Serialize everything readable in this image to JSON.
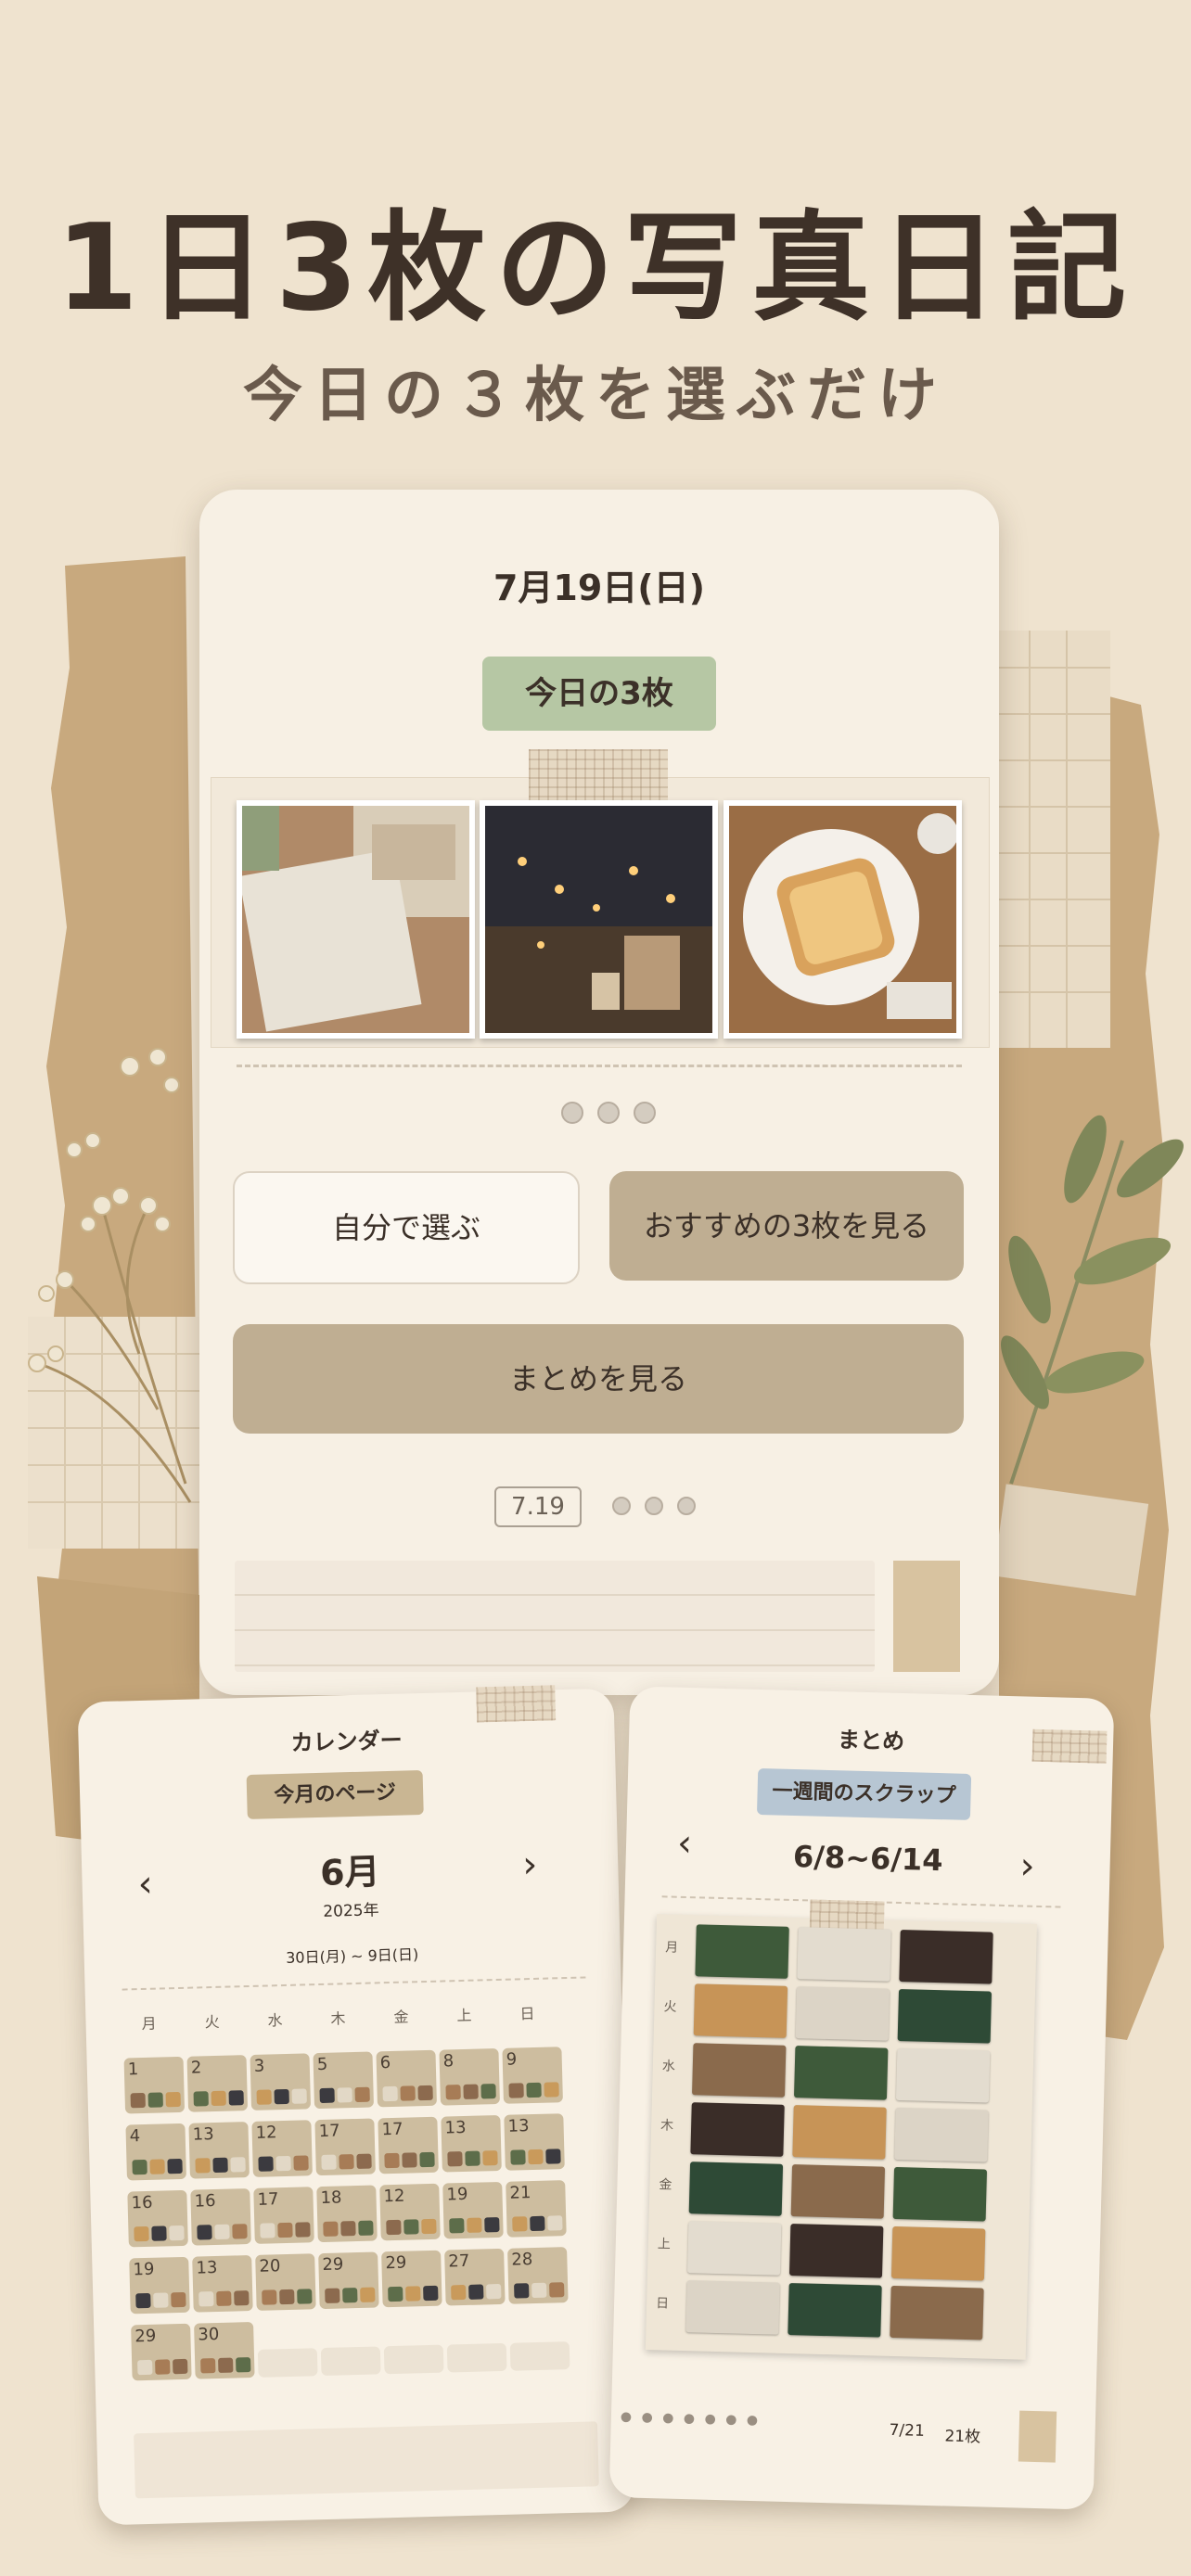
{
  "headline": "1日3枚の写真日記",
  "subline": "今日の３枚を選ぶだけ",
  "phone": {
    "date": "7月19日(日)",
    "today_pill": "今日の3枚",
    "buttons": {
      "choose_self": "自分で選ぶ",
      "recommended": "おすすめの3枚を見る",
      "summary": "まとめを見る"
    },
    "mini_date": "7.19"
  },
  "calendar_card": {
    "title": "カレンダー",
    "chip": "今月のページ",
    "month": "6月",
    "year": "2025年",
    "range": "30日(月) ~ 9日(日)",
    "weekdays": [
      "月",
      "火",
      "水",
      "木",
      "金",
      "上",
      "日"
    ],
    "rows": [
      [
        "1",
        "2",
        "3",
        "5",
        "6",
        "8",
        "9"
      ],
      [
        "4",
        "13",
        "12",
        "17",
        "17",
        "13",
        "13"
      ],
      [
        "16",
        "16",
        "17",
        "18",
        "12",
        "19",
        "21"
      ],
      [
        "19",
        "13",
        "20",
        "29",
        "29",
        "27",
        "28"
      ],
      [
        "29",
        "30",
        "",
        "",
        "",
        "",
        ""
      ]
    ],
    "faded_days": [
      "",
      "8",
      "",
      "",
      "9"
    ]
  },
  "summary_card": {
    "title": "まとめ",
    "chip": "一週間のスクラップ",
    "range": "6/8~6/14",
    "weekdays": [
      "月",
      "火",
      "水",
      "木",
      "金",
      "上",
      "日"
    ],
    "footer_date": "7/21",
    "footer_count": "21枚"
  },
  "colors": {
    "background": "#efe3cf",
    "kraft": "#c8a97e",
    "green_chip": "#b6c7a4",
    "button_fill": "#bfae92",
    "blue_chip": "#b7c6d3"
  }
}
